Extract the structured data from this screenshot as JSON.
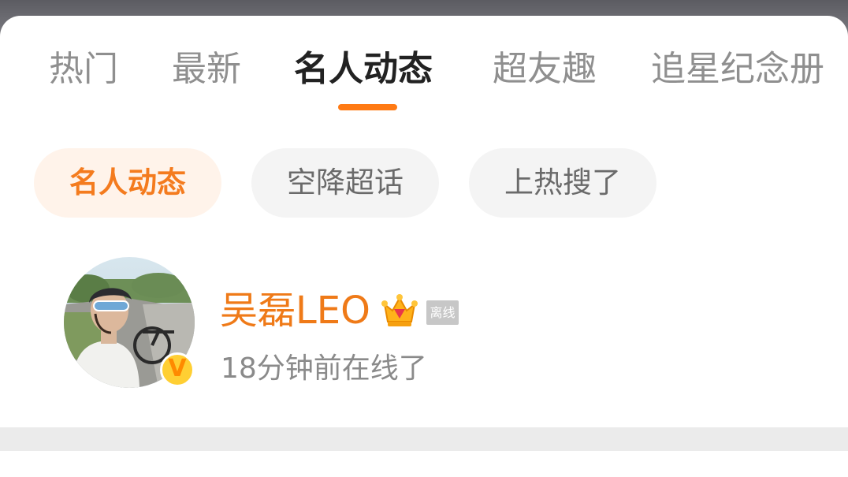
{
  "tabs": [
    {
      "label": "热门",
      "active": false
    },
    {
      "label": "最新",
      "active": false
    },
    {
      "label": "名人动态",
      "active": true
    },
    {
      "label": "超友趣",
      "active": false
    },
    {
      "label": "追星纪念册",
      "active": false
    }
  ],
  "chips": [
    {
      "label": "名人动态",
      "active": true
    },
    {
      "label": "空降超话",
      "active": false
    },
    {
      "label": "上热搜了",
      "active": false
    }
  ],
  "profile": {
    "name": "吴磊LEO",
    "status_tag": "离线",
    "last_seen": "18分钟前在线了",
    "badge_icon": "vip-crown-icon",
    "verified_icon": "verified-v-icon"
  },
  "colors": {
    "accent": "#ff7a14",
    "name_orange": "#ef7a18",
    "chip_active_bg": "#fff3ea",
    "chip_bg": "#f4f4f4"
  }
}
